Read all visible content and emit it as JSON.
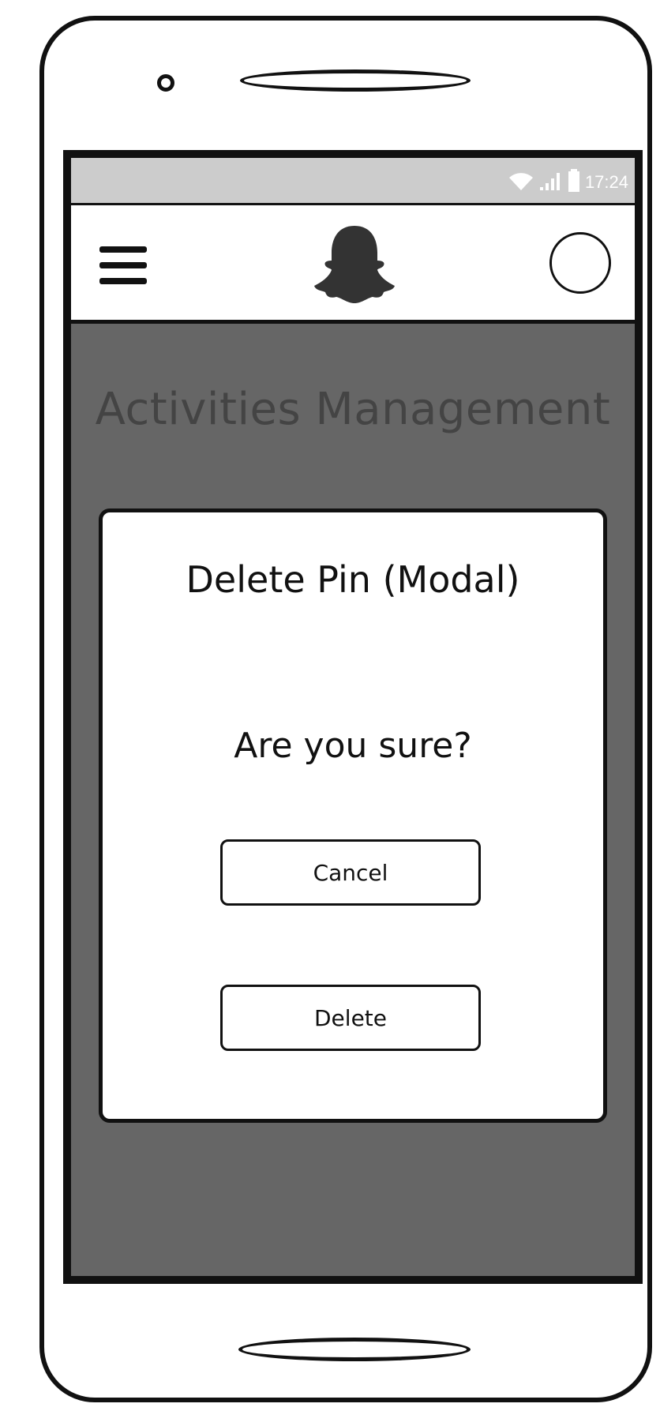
{
  "status_bar": {
    "time": "17:24",
    "icons": [
      "wifi-icon",
      "signal-icon",
      "battery-icon"
    ]
  },
  "app_bar": {
    "menu_icon": "hamburger-menu-icon",
    "logo_icon": "ghost-logo-icon",
    "profile_icon": "profile-circle-icon"
  },
  "page": {
    "title": "Activities Management"
  },
  "modal": {
    "title": "Delete Pin (Modal)",
    "question": "Are you sure?",
    "cancel_label": "Cancel",
    "delete_label": "Delete"
  },
  "colors": {
    "screen_background": "#666666",
    "status_bar_background": "#cccccc",
    "title_text": "#444444",
    "outline": "#111111"
  }
}
